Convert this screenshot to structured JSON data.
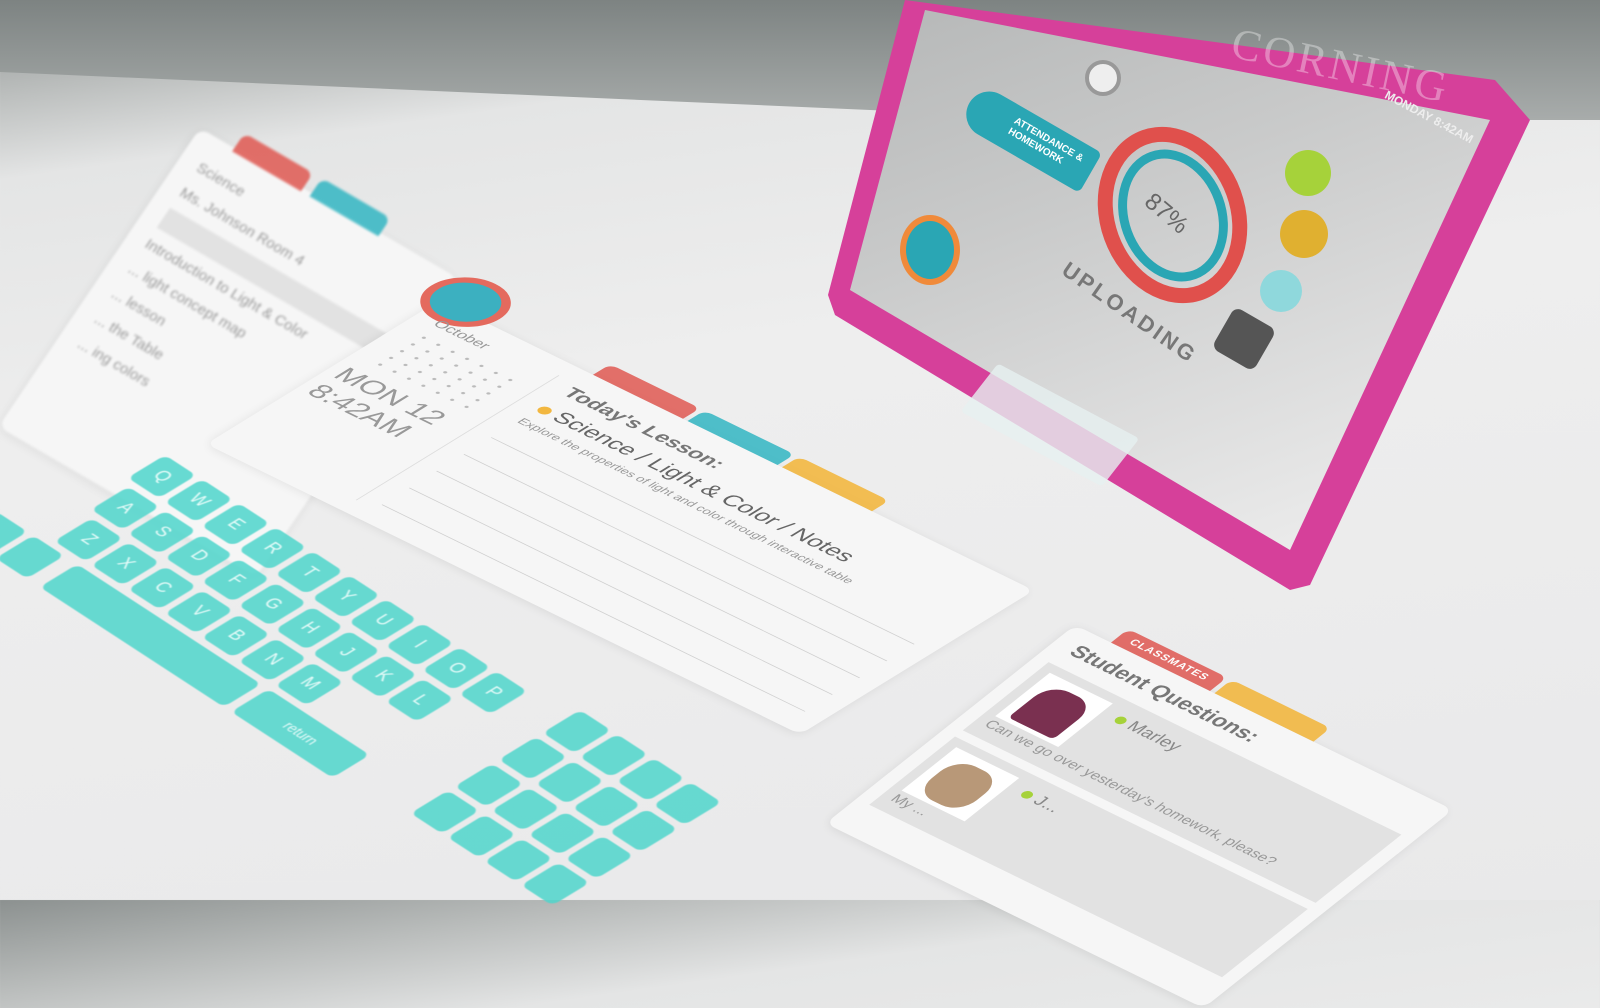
{
  "tablet": {
    "brand": "CORNING",
    "datetime": "MONDAY 8:42AM",
    "attendance_label": "ATTENDANCE & HOMEWORK",
    "progress_percent": 87,
    "progress_text": "87%",
    "status": "UPLOADING",
    "colors": {
      "frame": "#d6409a",
      "ring_outer": "#e0504c",
      "ring_inner": "#2aa6b4"
    }
  },
  "lesson_card": {
    "calendar_month": "October",
    "date": "MON 12",
    "time": "8:42AM",
    "heading": "Today's Lesson:",
    "subject": "Science / Light & Color / Notes",
    "description": "Explore the properties of light and color through interactive table"
  },
  "left_panel": {
    "lines": [
      "Science",
      "Ms. Johnson   Room 4",
      "Introduction to Light & Color",
      "... light concept map",
      "... lesson",
      "... the Table",
      "... ing colors"
    ]
  },
  "keyboard": {
    "rows": [
      [
        "Q",
        "W",
        "E",
        "R",
        "T",
        "Y",
        "U",
        "I",
        "O",
        "P"
      ],
      [
        "A",
        "S",
        "D",
        "F",
        "G",
        "H",
        "J",
        "K",
        "L"
      ],
      [
        "Z",
        "X",
        "C",
        "V",
        "B",
        "N",
        "M"
      ]
    ],
    "return_label": "return",
    "color": "#4fd6cc"
  },
  "questions_card": {
    "tab_classmates": "CLASSMATES",
    "heading": "Student Questions:",
    "questions": [
      {
        "name": "Marley",
        "text": "Can we go over yesterday's homework, please?"
      },
      {
        "name": "J...",
        "text": "My ..."
      }
    ]
  }
}
